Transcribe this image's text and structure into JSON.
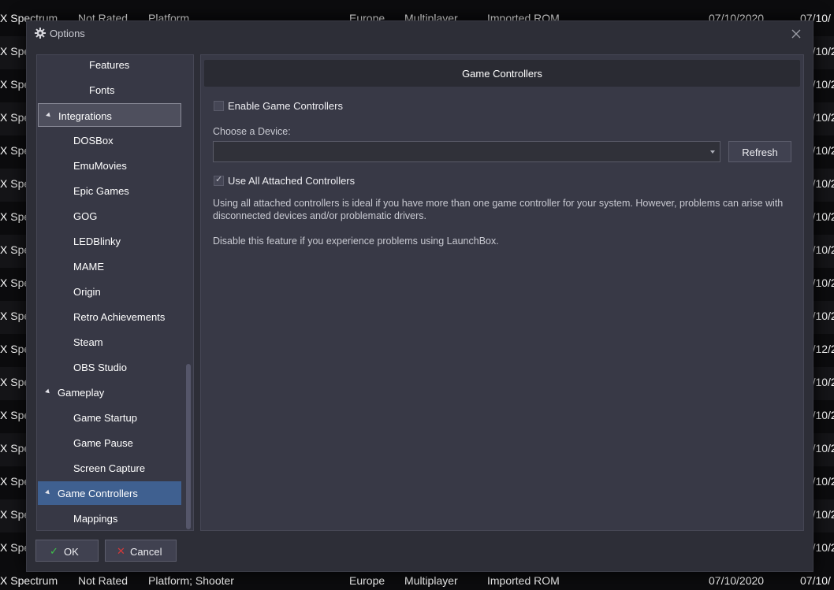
{
  "background_list": {
    "top_row": [
      "X Spectrum",
      "Not Rated",
      "Platform",
      "Europe",
      "Multiplayer",
      "Imported ROM",
      "07/10/2020",
      "07/10/"
    ],
    "bottom_row": [
      "X Spectrum",
      "Not Rated",
      "Platform; Shooter",
      "Europe",
      "Multiplayer",
      "Imported ROM",
      "07/10/2020",
      "07/10/"
    ],
    "left_fragments": [
      "X Spe",
      "X Spe",
      "X Spe",
      "X Spe",
      "X Spe",
      "X Spe",
      "X Spe",
      "X Spe",
      "X Spe",
      "X Spe",
      "X Spe",
      "X Spe",
      "X Spe",
      "X Spe",
      "X Spe",
      "X Spe"
    ],
    "right_fragments": [
      "07/10/2",
      "07/10/2",
      "07/10/2",
      "07/10/2",
      "07/10/2",
      "07/10/2",
      "07/10/2",
      "07/10/2",
      "07/10/2",
      "07/12/2",
      "07/10/2",
      "07/10/2",
      "07/10/2",
      "07/10/2",
      "07/10/2",
      "07/10/2"
    ]
  },
  "dialog": {
    "title": "Options",
    "title_icon": "gear-icon",
    "close_icon": "close-icon"
  },
  "sidebar": {
    "items": [
      {
        "label": "Features",
        "level": 2
      },
      {
        "label": "Fonts",
        "level": 2
      },
      {
        "label": "Integrations",
        "level": 1,
        "expanded": true,
        "state": "hover"
      },
      {
        "label": "DOSBox",
        "level": 2
      },
      {
        "label": "EmuMovies",
        "level": 2
      },
      {
        "label": "Epic Games",
        "level": 2
      },
      {
        "label": "GOG",
        "level": 2
      },
      {
        "label": "LEDBlinky",
        "level": 2
      },
      {
        "label": "MAME",
        "level": 2
      },
      {
        "label": "Origin",
        "level": 2
      },
      {
        "label": "Retro Achievements",
        "level": 2
      },
      {
        "label": "Steam",
        "level": 2
      },
      {
        "label": "OBS Studio",
        "level": 2
      },
      {
        "label": "Gameplay",
        "level": 1,
        "expanded": true
      },
      {
        "label": "Game Startup",
        "level": 2
      },
      {
        "label": "Game Pause",
        "level": 2
      },
      {
        "label": "Screen Capture",
        "level": 2
      },
      {
        "label": "Game Controllers",
        "level": 1,
        "expanded": true,
        "state": "selected"
      },
      {
        "label": "Mappings",
        "level": 2
      }
    ]
  },
  "content": {
    "header": "Game Controllers",
    "enable_label": "Enable Game Controllers",
    "enable_checked": false,
    "device_label": "Choose a Device:",
    "device_value": "",
    "refresh_label": "Refresh",
    "use_all_label": "Use All Attached Controllers",
    "use_all_checked": true,
    "description_1": "Using all attached controllers is ideal if you have more than one game controller for your system. However, problems can arise with disconnected devices and/or problematic drivers.",
    "description_2": "Disable this feature if you experience problems using LaunchBox."
  },
  "footer": {
    "ok_label": "OK",
    "ok_icon": "checkmark-icon",
    "cancel_label": "Cancel",
    "cancel_icon": "cross-icon"
  },
  "colors": {
    "accent_selected": "#3f6090",
    "ok_icon": "#3fc24a",
    "cancel_icon": "#d23a3a"
  }
}
